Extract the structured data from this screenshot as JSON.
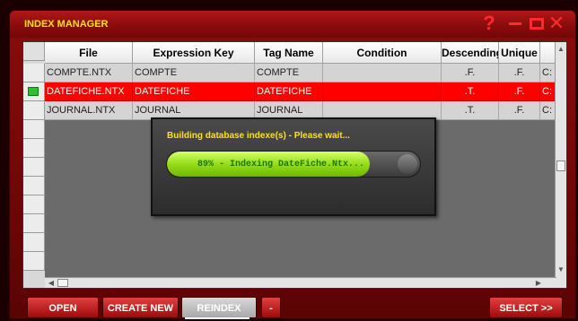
{
  "window": {
    "title": "INDEX MANAGER",
    "help_label": "?",
    "accent_color": "#ff2a2a",
    "title_color": "#ffe600"
  },
  "table": {
    "columns": [
      "File",
      "Expression Key",
      "Tag Name",
      "Condition",
      "Descending",
      "Unique",
      ""
    ],
    "rows": [
      {
        "file": "COMPTE.NTX",
        "expr": "COMPTE",
        "tag": "COMPTE",
        "condition": "",
        "descending": ".F.",
        "unique": ".F.",
        "path": "C:",
        "selected": false
      },
      {
        "file": "DATEFICHE.NTX",
        "expr": "DATEFICHE",
        "tag": "DATEFICHE",
        "condition": "",
        "descending": ".T.",
        "unique": ".F.",
        "path": "C:",
        "selected": true
      },
      {
        "file": "JOURNAL.NTX",
        "expr": "JOURNAL",
        "tag": "JOURNAL",
        "condition": "",
        "descending": ".T.",
        "unique": ".F.",
        "path": "C:",
        "selected": false
      }
    ]
  },
  "progress": {
    "message": "Building database indexe(s) - Please wait...",
    "percent": 89,
    "bar_text": "89% - Indexing DateFiche.Ntx..."
  },
  "footer": {
    "open": "OPEN",
    "create_new": "CREATE NEW",
    "reindex": "REINDEX",
    "dash": "-",
    "select": "SELECT >>"
  }
}
